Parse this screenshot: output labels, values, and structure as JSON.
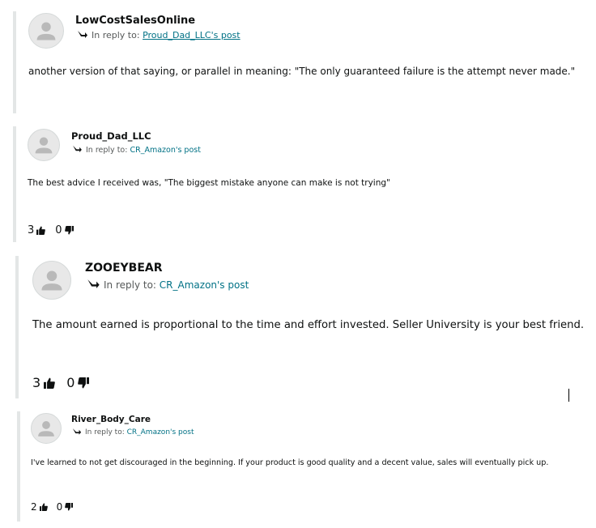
{
  "posts": [
    {
      "author": "LowCostSalesOnline",
      "reply_prefix": "In reply to:",
      "reply_target": "Proud_Dad_LLC's post",
      "text": "another version of that saying, or parallel in meaning: \"The only guaranteed failure is the attempt never made.\""
    },
    {
      "author": "Proud_Dad_LLC",
      "reply_prefix": "In reply to:",
      "reply_target": "CR_Amazon's post",
      "text": "The best advice I received was, \"The biggest mistake anyone can make is not trying\"",
      "upvotes": "3",
      "downvotes": "0"
    },
    {
      "author": "ZOOEYBEAR",
      "reply_prefix": "In reply to:",
      "reply_target": "CR_Amazon's post",
      "text": "The amount earned is proportional to the time and effort invested. Seller University is your best friend.",
      "upvotes": "3",
      "downvotes": "0"
    },
    {
      "author": "River_Body_Care",
      "reply_prefix": "In reply to:",
      "reply_target": "CR_Amazon's post",
      "text": "I've learned to not get discouraged in the beginning. If your product is good quality and a decent value, sales will eventually pick up.",
      "upvotes": "2",
      "downvotes": "0"
    }
  ],
  "icons": {
    "avatar": "user-silhouette-icon",
    "reply": "reply-arrow-icon",
    "upvote": "thumbs-up-icon",
    "downvote": "thumbs-down-icon"
  },
  "colors": {
    "link": "#007185",
    "secondary_text": "#565959",
    "thread_bar": "#e3e6e6",
    "avatar_bg": "#e8e8e8",
    "avatar_figure": "#b9b9b9"
  }
}
